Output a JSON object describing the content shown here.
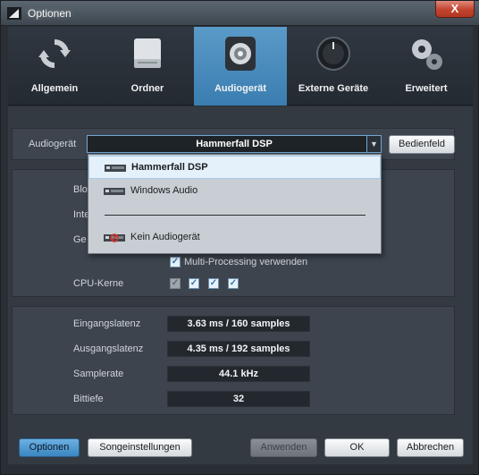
{
  "window": {
    "title": "Optionen",
    "close_label": "X"
  },
  "tabs": [
    {
      "label": "Allgemein",
      "icon": "refresh-icon",
      "active": false
    },
    {
      "label": "Ordner",
      "icon": "drive-icon",
      "active": false
    },
    {
      "label": "Audiogerät",
      "icon": "speaker-icon",
      "active": true
    },
    {
      "label": "Externe Geräte",
      "icon": "knob-icon",
      "active": false
    },
    {
      "label": "Erweitert",
      "icon": "gears-icon",
      "active": false
    }
  ],
  "audio_device": {
    "label": "Audiogerät",
    "selected": "Hammerfall DSP",
    "control_panel_button": "Bedienfeld"
  },
  "dropdown": {
    "items": [
      {
        "label": "Hammerfall DSP",
        "selected": true
      },
      {
        "label": "Windows Audio",
        "selected": false
      },
      {
        "label": "Kein Audiogerät",
        "selected": false
      }
    ]
  },
  "settings": {
    "block_label": "Blo",
    "internal_label": "Inte",
    "device_label": "Ge",
    "multiprocessing_label": "Multi-Processing verwenden",
    "multiprocessing_checked": true,
    "cpu_cores_label": "CPU-Kerne",
    "cpu_cores": [
      {
        "checked": true,
        "enabled": false
      },
      {
        "checked": true,
        "enabled": true
      },
      {
        "checked": true,
        "enabled": true
      },
      {
        "checked": true,
        "enabled": true
      }
    ]
  },
  "info": {
    "input_latency_label": "Eingangslatenz",
    "input_latency_value": "3.63 ms / 160 samples",
    "output_latency_label": "Ausgangslatenz",
    "output_latency_value": "4.35 ms / 192 samples",
    "samplerate_label": "Samplerate",
    "samplerate_value": "44.1 kHz",
    "bitdepth_label": "Bittiefe",
    "bitdepth_value": "32"
  },
  "footer": {
    "options_button": "Optionen",
    "song_settings_button": "Songeinstellungen",
    "apply_button": "Anwenden",
    "ok_button": "OK",
    "cancel_button": "Abbrechen"
  },
  "colors": {
    "accent": "#3a7db0",
    "background": "#343a42",
    "close": "#c2432e"
  }
}
